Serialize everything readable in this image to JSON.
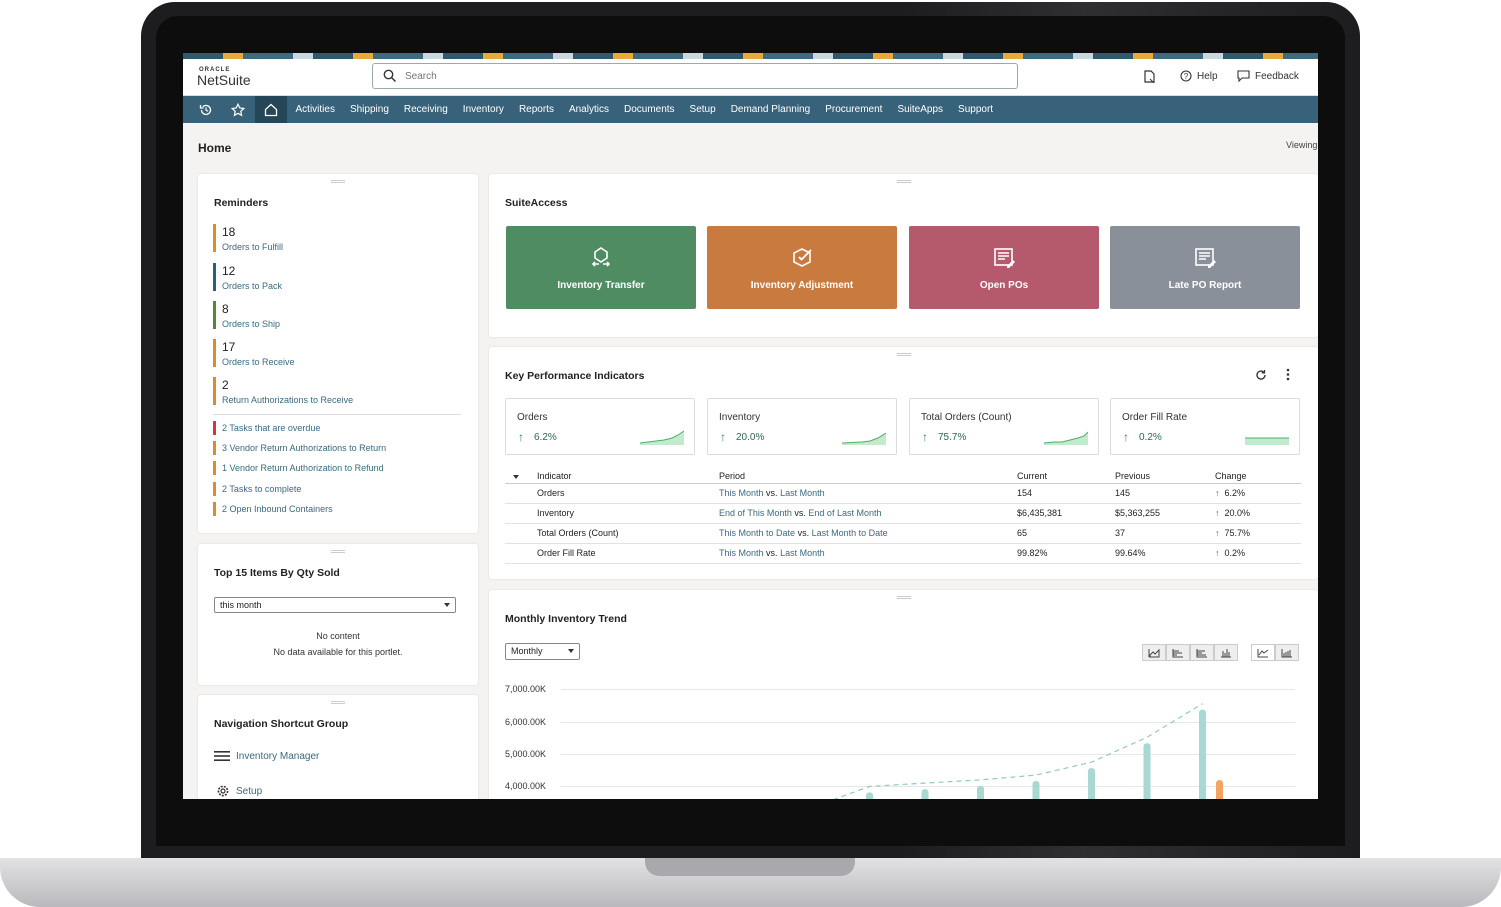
{
  "header": {
    "logo_oracle": "ORACLE",
    "logo_product": "NetSuite",
    "search_placeholder": "Search",
    "help_label": "Help",
    "feedback_label": "Feedback"
  },
  "nav": {
    "items": [
      "Activities",
      "Shipping",
      "Receiving",
      "Inventory",
      "Reports",
      "Analytics",
      "Documents",
      "Setup",
      "Demand Planning",
      "Procurement",
      "SuiteApps",
      "Support"
    ]
  },
  "page": {
    "title": "Home",
    "viewing_label": "Viewing"
  },
  "reminders": {
    "title": "Reminders",
    "items": [
      {
        "count": "18",
        "label": "Orders to Fulfill",
        "color": "#e08a2e"
      },
      {
        "count": "12",
        "label": "Orders to Pack",
        "color": "#2a5f7c"
      },
      {
        "count": "8",
        "label": "Orders to Ship",
        "color": "#4e8a3a"
      },
      {
        "count": "17",
        "label": "Orders to Receive",
        "color": "#e08a2e"
      },
      {
        "count": "2",
        "label": "Return Authorizations to Receive",
        "color": "#e08a2e"
      }
    ],
    "small_items": [
      {
        "text": "2   Tasks that are overdue",
        "color": "#d0393a"
      },
      {
        "text": "3   Vendor Return Authorizations to Return",
        "color": "#e08a2e"
      },
      {
        "text": "1   Vendor Return Authorization to Refund",
        "color": "#e08a2e"
      },
      {
        "text": "2   Tasks to complete",
        "color": "#e08a2e"
      },
      {
        "text": "2   Open Inbound Containers",
        "color": "#e08a2e"
      }
    ]
  },
  "top_items": {
    "title": "Top 15 Items By Qty Sold",
    "select_value": "this month",
    "no_content": "No content",
    "no_data": "No data available for this portlet."
  },
  "shortcuts": {
    "title": "Navigation Shortcut Group",
    "items": [
      {
        "label": "Inventory Manager",
        "icon": "menu-icon"
      },
      {
        "label": "Setup",
        "icon": "gear-icon"
      }
    ]
  },
  "suiteaccess": {
    "title": "SuiteAccess",
    "tiles": [
      {
        "label": "Inventory Transfer",
        "color": "#4f8c62",
        "icon": "transfer-icon"
      },
      {
        "label": "Inventory Adjustment",
        "color": "#c97a3f",
        "icon": "box-check-icon"
      },
      {
        "label": "Open POs",
        "color": "#b5596d",
        "icon": "report-icon"
      },
      {
        "label": "Late PO Report",
        "color": "#8a909a",
        "icon": "report-icon"
      }
    ]
  },
  "kpi": {
    "title": "Key Performance Indicators",
    "cards": [
      {
        "name": "Orders",
        "value": "6.2%"
      },
      {
        "name": "Inventory",
        "value": "20.0%"
      },
      {
        "name": "Total Orders (Count)",
        "value": "75.7%"
      },
      {
        "name": "Order Fill Rate",
        "value": "0.2%"
      }
    ],
    "table": {
      "headers": [
        "Indicator",
        "Period",
        "Current",
        "Previous",
        "Change"
      ],
      "rows": [
        {
          "indicator": "Orders",
          "period_a": "This Month",
          "period_b": "Last Month",
          "current": "154",
          "previous": "145",
          "change": "6.2%"
        },
        {
          "indicator": "Inventory",
          "period_a": "End of This Month",
          "period_b": "End of Last Month",
          "current": "$6,435,381",
          "previous": "$5,363,255",
          "change": "20.0%"
        },
        {
          "indicator": "Total Orders (Count)",
          "period_a": "This Month to Date",
          "period_b": "Last Month to Date",
          "current": "65",
          "previous": "37",
          "change": "75.7%"
        },
        {
          "indicator": "Order Fill Rate",
          "period_a": "This Month",
          "period_b": "Last Month",
          "current": "99.82%",
          "previous": "99.64%",
          "change": "0.2%"
        }
      ],
      "vs": "vs."
    }
  },
  "trend": {
    "title": "Monthly Inventory Trend",
    "select_value": "Monthly"
  },
  "chart_data": {
    "type": "bar",
    "title": "Monthly Inventory Trend",
    "y_tick_labels": [
      "7,000.00K",
      "6,000.00K",
      "5,000.00K",
      "4,000.00K"
    ],
    "ylim": [
      3800,
      7000
    ],
    "series": [
      {
        "color": "#a8d8d2",
        "values": [
          3800,
          3900,
          4000,
          4150,
          4550,
          5320,
          6360
        ]
      },
      {
        "color": "#f3a461",
        "values": [
          null,
          null,
          null,
          null,
          null,
          null,
          4180
        ]
      }
    ],
    "trendline": {
      "color": "#8fcbc4",
      "style": "dashed"
    }
  }
}
